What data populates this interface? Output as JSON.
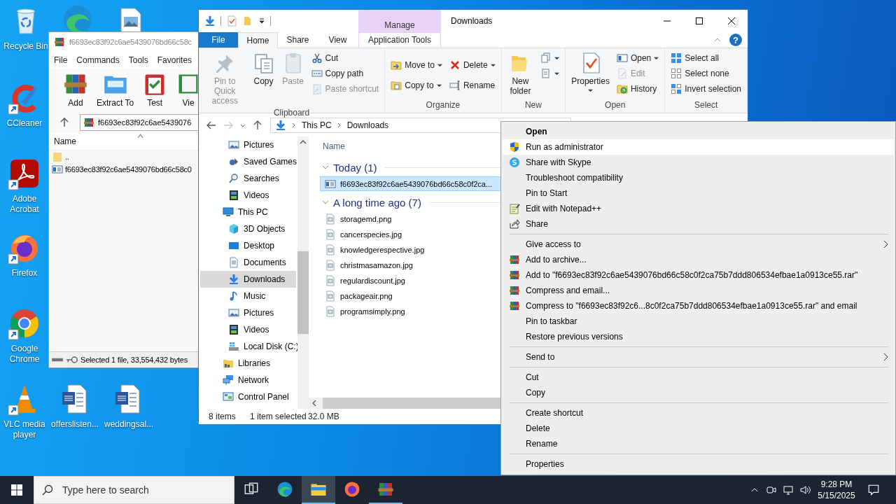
{
  "desktop_icons": [
    {
      "kind": "recyclebin",
      "label": "Recycle Bin",
      "shortcut": false
    },
    {
      "kind": "edge",
      "shortcut": false
    },
    {
      "kind": "image",
      "shortcut": false
    },
    {
      "kind": "cleaner",
      "label": "CCleaner",
      "shortcut": true
    },
    {
      "kind": "pdf",
      "label": "Adobe Acrobat",
      "shortcut": true
    },
    {
      "kind": "firefox",
      "label": "Firefox",
      "shortcut": true
    },
    {
      "kind": "chrome",
      "label": "Google Chrome",
      "shortcut": true
    },
    {
      "kind": "vlc",
      "label": "VLC media player",
      "shortcut": true
    },
    {
      "kind": "document",
      "label": "offerslisten...",
      "shortcut": false
    },
    {
      "kind": "document",
      "label": "weddingsal...",
      "shortcut": false
    }
  ],
  "winrar": {
    "title": "f6693ec83f92c6ae5439076bd66c58c",
    "menu": [
      "File",
      "Commands",
      "Tools",
      "Favorites"
    ],
    "tools": [
      {
        "kind": "add",
        "label": "Add"
      },
      {
        "kind": "extract",
        "label": "Extract To"
      },
      {
        "kind": "test",
        "label": "Test"
      },
      {
        "kind": "view",
        "label": "Vie"
      }
    ],
    "path": "f6693ec83f92c6ae5439076",
    "column": "Name",
    "rows": [
      {
        "kind": "up",
        "name": ".."
      },
      {
        "kind": "file",
        "name": "f6693ec83f92c6ae5439076bd66c58c0"
      }
    ],
    "status": "Selected 1 file, 33,554,432 bytes"
  },
  "explorer": {
    "title": "Downloads",
    "context_tab": "Manage",
    "help": "?",
    "tabs": [
      {
        "label": "File",
        "kind": "file",
        "selected": false
      },
      {
        "label": "Home",
        "kind": "normal",
        "selected": true
      },
      {
        "label": "Share",
        "kind": "normal",
        "selected": false
      },
      {
        "label": "View",
        "kind": "normal",
        "selected": false
      },
      {
        "label": "Application Tools",
        "kind": "contextual",
        "selected": false
      }
    ],
    "ribbon": [
      {
        "label": "Clipboard",
        "items": [
          {
            "kind": "pin",
            "label": "Pin to Quick access",
            "disabled": true,
            "dropdown": false
          },
          {
            "kind": "copy",
            "label": "Copy",
            "disabled": false,
            "dropdown": false
          },
          {
            "kind": "paste",
            "label": "Paste",
            "disabled": true,
            "dropdown": false
          },
          {
            "kind": "cut",
            "label": "Cut",
            "disabled": false,
            "dropdown": false
          },
          {
            "kind": "copypath",
            "label": "Copy path",
            "disabled": false,
            "dropdown": false
          },
          {
            "kind": "pasteshortcut",
            "label": "Paste shortcut",
            "disabled": true,
            "dropdown": false
          }
        ]
      },
      {
        "label": "Organize",
        "items": [
          {
            "kind": "moveto",
            "label": "Move to",
            "disabled": false,
            "dropdown": true
          },
          {
            "kind": "copyto",
            "label": "Copy to",
            "disabled": false,
            "dropdown": true
          },
          {
            "kind": "delete",
            "label": "Delete",
            "disabled": false,
            "dropdown": true
          },
          {
            "kind": "rename",
            "label": "Rename",
            "disabled": false,
            "dropdown": false
          }
        ]
      },
      {
        "label": "New",
        "items": [
          {
            "kind": "newfolder",
            "label": "New folder",
            "disabled": false,
            "dropdown": false
          },
          {
            "kind": "newitem",
            "disabled": false,
            "dropdown": true
          },
          {
            "kind": "easyaccess",
            "disabled": false,
            "dropdown": true
          }
        ]
      },
      {
        "label": "Open",
        "items": [
          {
            "kind": "properties",
            "label": "Properties",
            "disabled": false,
            "dropdown": true
          },
          {
            "kind": "open",
            "label": "Open",
            "disabled": false,
            "dropdown": true
          },
          {
            "kind": "edit",
            "label": "Edit",
            "disabled": true,
            "dropdown": false
          },
          {
            "kind": "history",
            "label": "History",
            "disabled": false,
            "dropdown": false
          }
        ]
      },
      {
        "label": "Select",
        "items": [
          {
            "kind": "selectall",
            "label": "Select all",
            "disabled": false,
            "dropdown": false
          },
          {
            "kind": "selectnone",
            "label": "Select none",
            "disabled": false,
            "dropdown": false
          },
          {
            "kind": "invert",
            "label": "Invert selection",
            "disabled": false,
            "dropdown": false
          }
        ]
      }
    ],
    "crumbs": [
      "This PC",
      "Downloads"
    ],
    "nav": [
      {
        "children": [
          {
            "kind": "pictures",
            "label": "Pictures",
            "selected": false
          },
          {
            "kind": "games",
            "label": "Saved Games",
            "selected": false
          },
          {
            "kind": "searches",
            "label": "Searches",
            "selected": false
          },
          {
            "kind": "videos",
            "label": "Videos",
            "selected": false
          }
        ]
      },
      {
        "kind": "computer",
        "label": "This PC",
        "selected": false,
        "children": [
          {
            "kind": "objects",
            "label": "3D Objects",
            "selected": false
          },
          {
            "kind": "desktop",
            "label": "Desktop",
            "selected": false
          },
          {
            "kind": "documents",
            "label": "Documents",
            "selected": false
          },
          {
            "kind": "downloads",
            "label": "Downloads",
            "selected": true
          },
          {
            "kind": "music",
            "label": "Music",
            "selected": false
          },
          {
            "kind": "pictures",
            "label": "Pictures",
            "selected": false
          },
          {
            "kind": "videos",
            "label": "Videos",
            "selected": false
          },
          {
            "kind": "disk",
            "label": "Local Disk (C:)",
            "selected": false
          }
        ]
      },
      {
        "kind": "libraries",
        "label": "Libraries",
        "selected": false
      },
      {
        "kind": "network",
        "label": "Network",
        "selected": false
      },
      {
        "kind": "controlpanel",
        "label": "Control Panel",
        "selected": false
      }
    ],
    "column": "Name",
    "groups": [
      {
        "label": "Today (1)",
        "expanded": true,
        "items": [
          {
            "kind": "app",
            "name": "f6693ec83f92c6ae5439076bd66c58c0f2ca...",
            "selected": true
          }
        ]
      },
      {
        "label": "A long time ago (7)",
        "expanded": true,
        "items": [
          {
            "kind": "image",
            "name": "storagemd.png",
            "selected": false
          },
          {
            "kind": "image",
            "name": "cancerspecies.jpg",
            "selected": false
          },
          {
            "kind": "image",
            "name": "knowledgerespective.jpg",
            "selected": false
          },
          {
            "kind": "image",
            "name": "christmasamazon.jpg",
            "selected": false
          },
          {
            "kind": "image",
            "name": "regulardiscount.jpg",
            "selected": false
          },
          {
            "kind": "image",
            "name": "packageair.png",
            "selected": false
          },
          {
            "kind": "image",
            "name": "programsimply.png",
            "selected": false
          }
        ]
      }
    ],
    "status": {
      "count": "8 items",
      "selection": "1 item selected",
      "size": "32.0 MB"
    }
  },
  "context_menu": [
    {
      "kind": "text",
      "label": "Open",
      "default": true,
      "selected": false,
      "submenu": false
    },
    {
      "kind": "shield",
      "label": "Run as administrator",
      "default": false,
      "selected": true,
      "submenu": false
    },
    {
      "kind": "skype",
      "label": "Share with Skype",
      "default": false,
      "selected": false,
      "submenu": false
    },
    {
      "kind": "text",
      "label": "Troubleshoot compatibility",
      "default": false,
      "selected": false,
      "submenu": false
    },
    {
      "kind": "text",
      "label": "Pin to Start",
      "default": false,
      "selected": false,
      "submenu": false
    },
    {
      "kind": "notepad",
      "label": "Edit with Notepad++",
      "default": false,
      "selected": false,
      "submenu": false
    },
    {
      "kind": "share",
      "label": "Share",
      "default": false,
      "selected": false,
      "submenu": false
    },
    {
      "kind": "separator"
    },
    {
      "kind": "text",
      "label": "Give access to",
      "default": false,
      "selected": false,
      "submenu": true
    },
    {
      "kind": "archive",
      "label": "Add to archive...",
      "default": false,
      "selected": false,
      "submenu": false
    },
    {
      "kind": "archive",
      "label": "Add to \"f6693ec83f92c6ae5439076bd66c58c0f2ca75b7ddd806534efbae1a0913ce55.rar\"",
      "default": false,
      "selected": false,
      "submenu": false
    },
    {
      "kind": "archive",
      "label": "Compress and email...",
      "default": false,
      "selected": false,
      "submenu": false
    },
    {
      "kind": "archive",
      "label": "Compress to \"f6693ec83f92c6...8c0f2ca75b7ddd806534efbae1a0913ce55.rar\" and email",
      "default": false,
      "selected": false,
      "submenu": false
    },
    {
      "kind": "text",
      "label": "Pin to taskbar",
      "default": false,
      "selected": false,
      "submenu": false
    },
    {
      "kind": "text",
      "label": "Restore previous versions",
      "default": false,
      "selected": false,
      "submenu": false
    },
    {
      "kind": "separator"
    },
    {
      "kind": "text",
      "label": "Send to",
      "default": false,
      "selected": false,
      "submenu": true
    },
    {
      "kind": "separator"
    },
    {
      "kind": "text",
      "label": "Cut",
      "default": false,
      "selected": false,
      "submenu": false
    },
    {
      "kind": "text",
      "label": "Copy",
      "default": false,
      "selected": false,
      "submenu": false
    },
    {
      "kind": "separator"
    },
    {
      "kind": "text",
      "label": "Create shortcut",
      "default": false,
      "selected": false,
      "submenu": false
    },
    {
      "kind": "text",
      "label": "Delete",
      "default": false,
      "selected": false,
      "submenu": false
    },
    {
      "kind": "text",
      "label": "Rename",
      "default": false,
      "selected": false,
      "submenu": false
    },
    {
      "kind": "separator"
    },
    {
      "kind": "text",
      "label": "Properties",
      "default": false,
      "selected": false,
      "submenu": false
    }
  ],
  "taskbar": {
    "search": {
      "placeholder": "Type here to search"
    },
    "apps": [
      {
        "kind": "taskview",
        "selected": false,
        "running": false
      },
      {
        "kind": "edge",
        "selected": false,
        "running": false
      },
      {
        "kind": "explorer",
        "selected": true,
        "running": true
      },
      {
        "kind": "firefox",
        "selected": false,
        "running": false
      },
      {
        "kind": "winrar",
        "selected": false,
        "running": true
      }
    ],
    "clock": {
      "time": "9:28 PM",
      "date": "5/15/2025"
    }
  }
}
